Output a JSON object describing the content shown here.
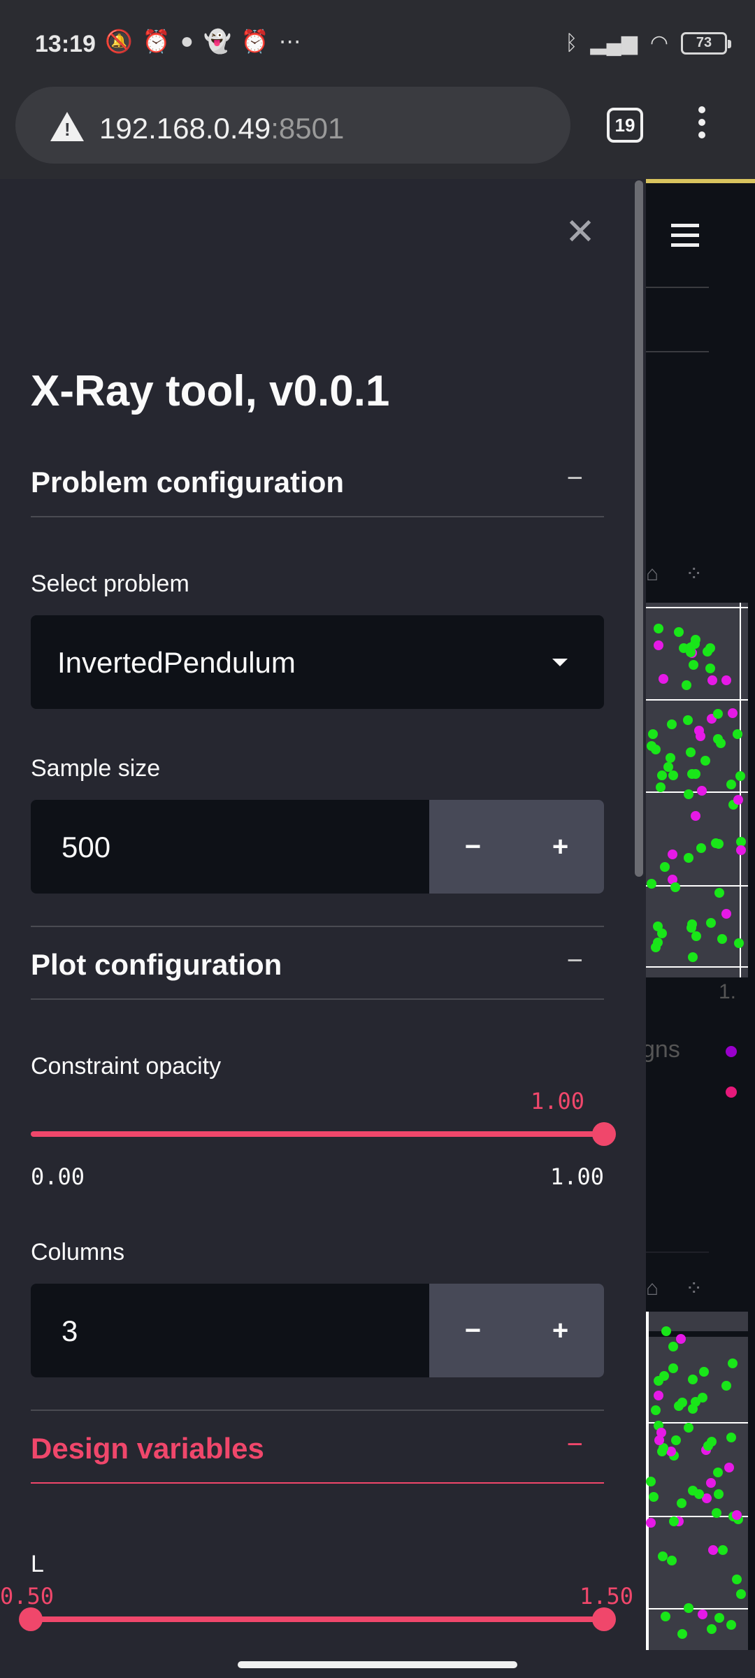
{
  "status_bar": {
    "time": "13:19",
    "left_icons": [
      "mute-bell-icon",
      "alarm-icon",
      "chat-bubble-icon",
      "snapchat-icon",
      "alarm-icon",
      "more-dots-icon"
    ],
    "right_icons": [
      "bluetooth-icon",
      "signal-icon",
      "wifi-icon"
    ],
    "battery": "73"
  },
  "browser": {
    "url_host": "192.168.0.49",
    "url_port": ":8501",
    "tab_count": "19"
  },
  "sidebar": {
    "close_symbol": "✕",
    "app_title": "X-Ray tool, v0.0.1",
    "problem_section": {
      "title": "Problem configuration",
      "collapse_symbol": "−",
      "select_label": "Select problem",
      "select_value": "InvertedPendulum",
      "sample_label": "Sample size",
      "sample_value": "500",
      "minus": "−",
      "plus": "+"
    },
    "plot_section": {
      "title": "Plot configuration",
      "collapse_symbol": "−",
      "opacity_label": "Constraint opacity",
      "opacity_value": "1.00",
      "opacity_min": "0.00",
      "opacity_max": "1.00",
      "opacity_level": 1.0,
      "columns_label": "Columns",
      "columns_value": "3",
      "minus": "−",
      "plus": "+"
    },
    "design_section": {
      "title": "Design variables",
      "collapse_symbol": "−",
      "l_label": "L",
      "l_low": "0.50",
      "l_high": "1.50"
    }
  },
  "main": {
    "axis_tick_partial": "1.",
    "legend_partial": "gns",
    "colors": {
      "feasible": "#19e619",
      "infeasible": "#e619e6",
      "legend_dot_1": "#9900cc",
      "legend_dot_2": "#e6197a"
    }
  }
}
